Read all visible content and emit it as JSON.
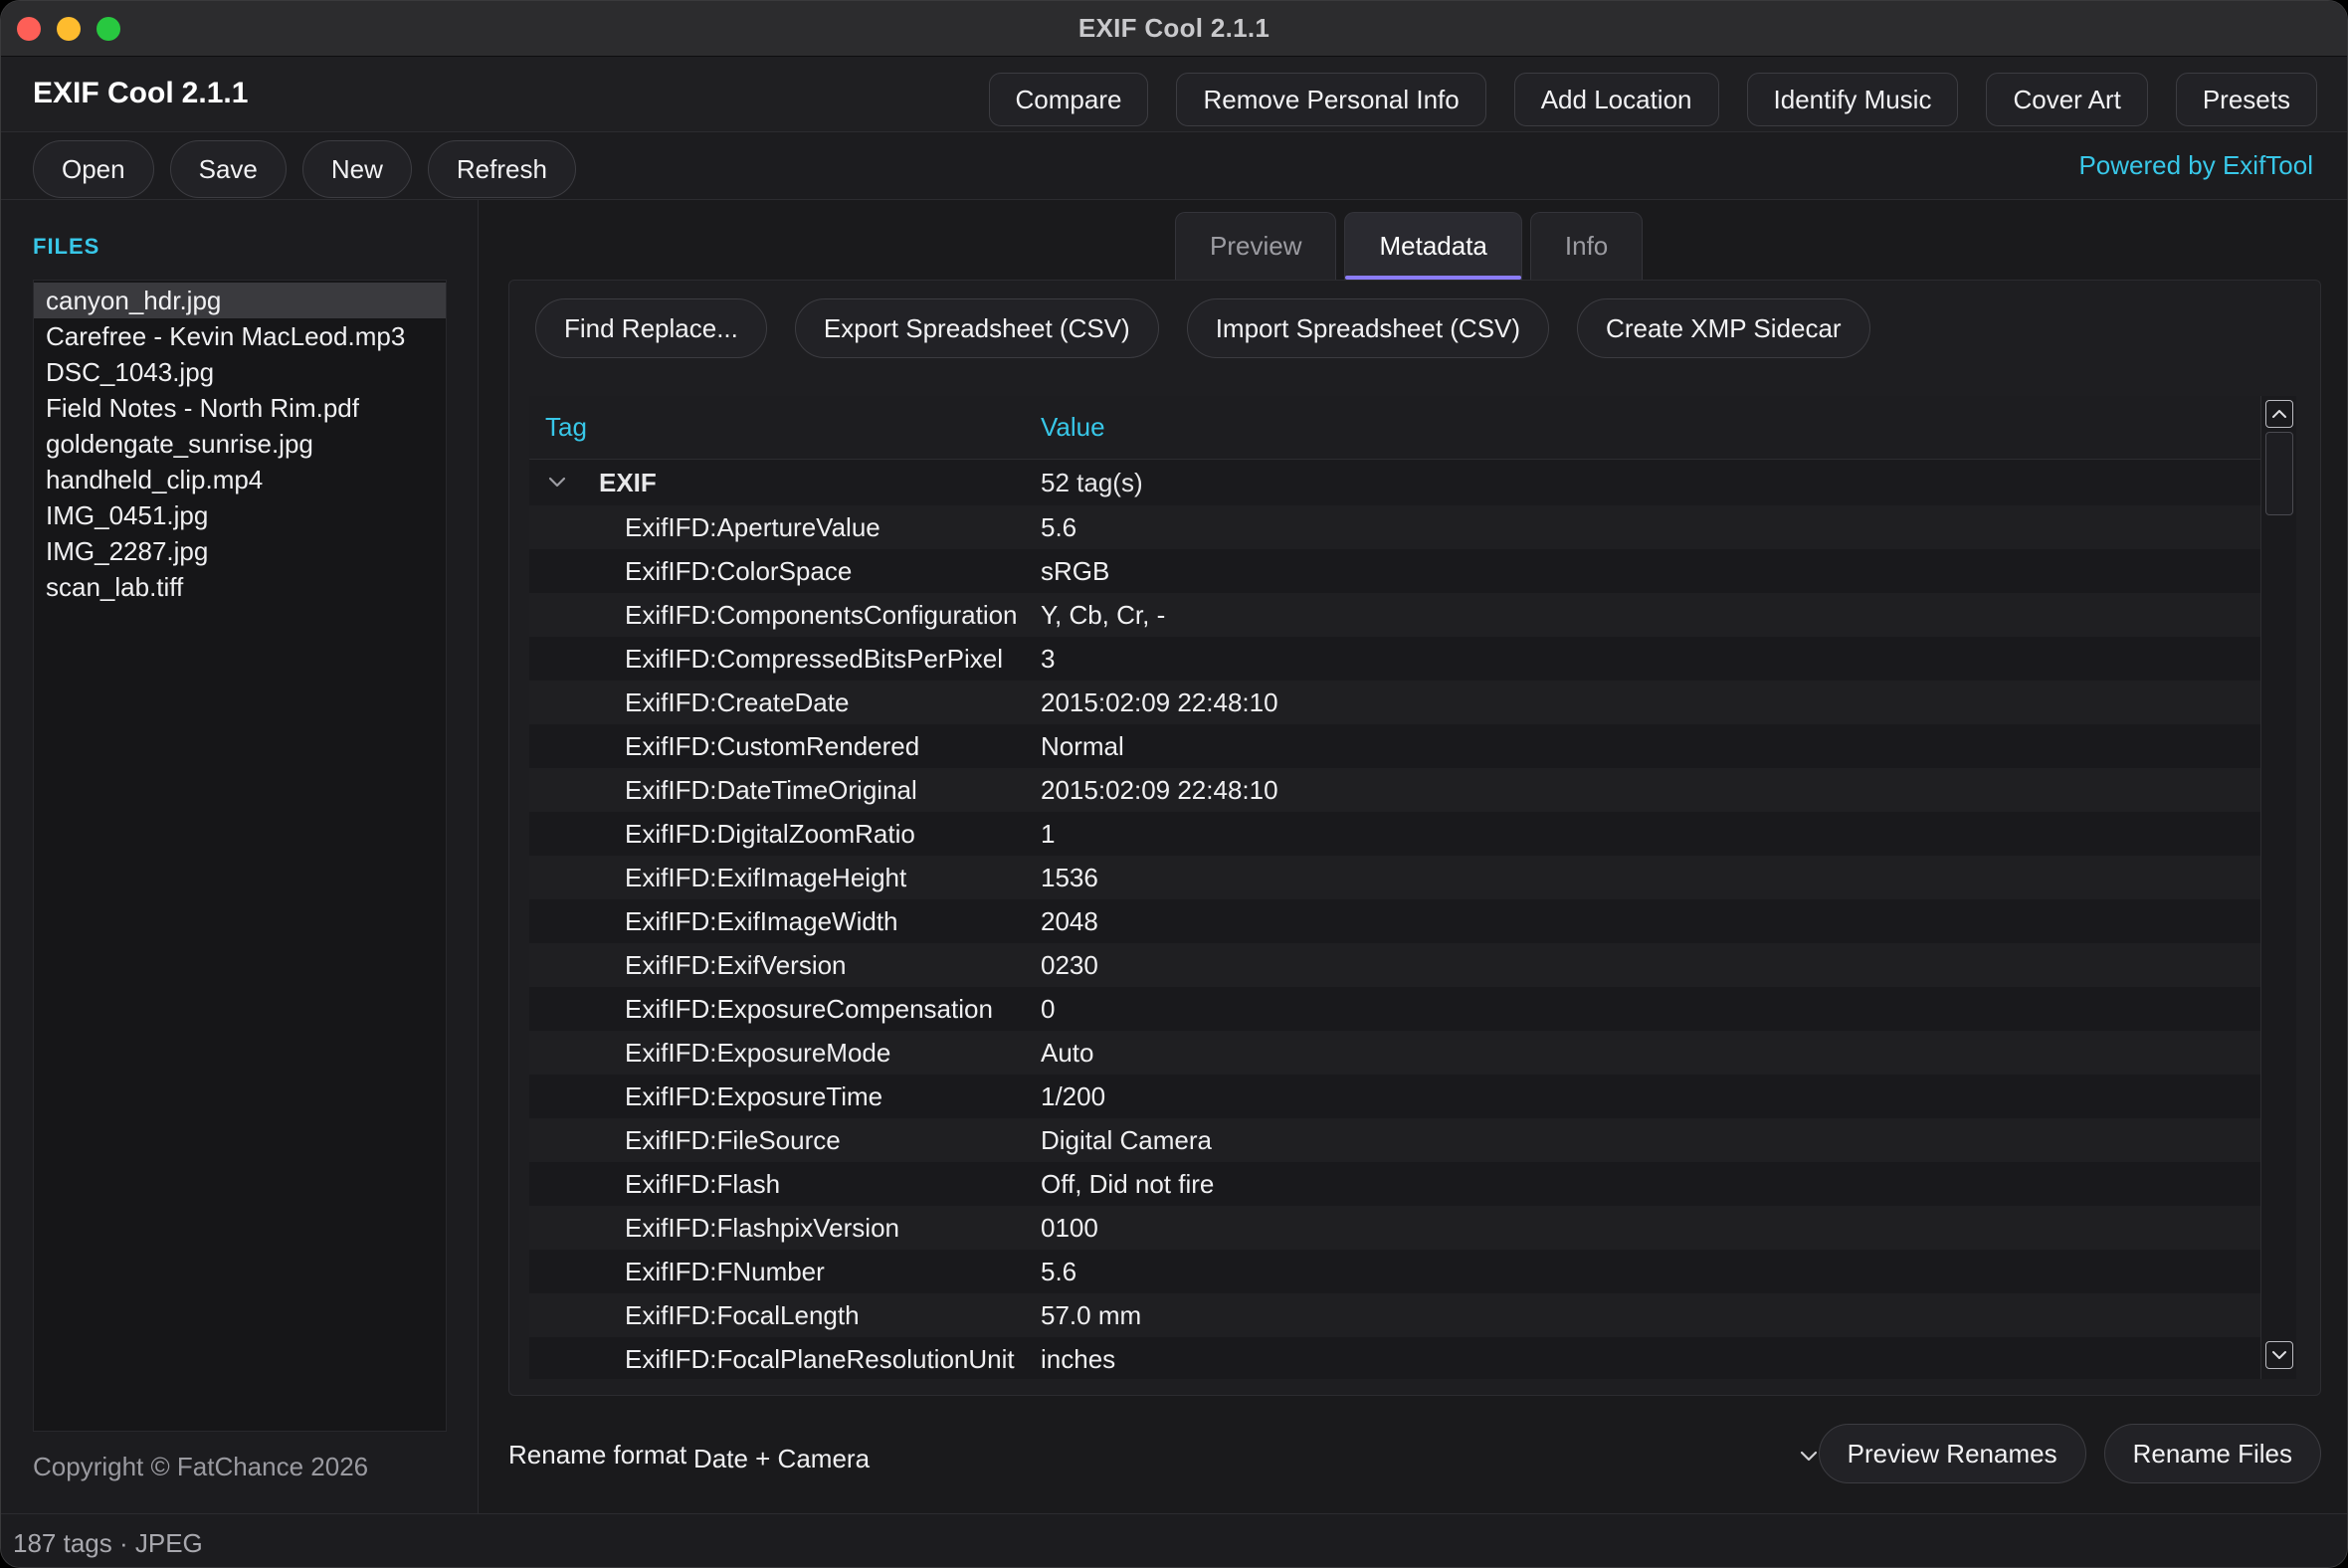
{
  "window": {
    "title": "EXIF Cool 2.1.1"
  },
  "header": {
    "app_name": "EXIF Cool",
    "app_version": "2.1.1",
    "actions": [
      "Compare",
      "Remove Personal Info",
      "Add Location",
      "Identify Music",
      "Cover Art",
      "Presets"
    ]
  },
  "toolbar": {
    "buttons": [
      "Open",
      "Save",
      "New",
      "Refresh"
    ],
    "powered_by": "Powered by ExifTool"
  },
  "sidebar": {
    "label": "FILES",
    "files": [
      "canyon_hdr.jpg",
      "Carefree - Kevin MacLeod.mp3",
      "DSC_1043.jpg",
      "Field Notes - North Rim.pdf",
      "goldengate_sunrise.jpg",
      "handheld_clip.mp4",
      "IMG_0451.jpg",
      "IMG_2287.jpg",
      "scan_lab.tiff"
    ],
    "selected_file": "canyon_hdr.jpg",
    "copyright": "Copyright © FatChance 2026"
  },
  "tabs": [
    "Preview",
    "Metadata",
    "Info"
  ],
  "active_tab": "Metadata",
  "panel_actions": [
    "Find  Replace...",
    "Export Spreadsheet (CSV)",
    "Import Spreadsheet (CSV)",
    "Create XMP Sidecar"
  ],
  "table": {
    "headers": {
      "tag": "Tag",
      "value": "Value"
    },
    "group": {
      "name": "EXIF",
      "count": "52 tag(s)"
    },
    "rows": [
      {
        "tag": "ExifIFD:ApertureValue",
        "value": "5.6"
      },
      {
        "tag": "ExifIFD:ColorSpace",
        "value": "sRGB"
      },
      {
        "tag": "ExifIFD:ComponentsConfiguration",
        "value": "Y, Cb, Cr, -"
      },
      {
        "tag": "ExifIFD:CompressedBitsPerPixel",
        "value": "3"
      },
      {
        "tag": "ExifIFD:CreateDate",
        "value": "2015:02:09 22:48:10"
      },
      {
        "tag": "ExifIFD:CustomRendered",
        "value": "Normal"
      },
      {
        "tag": "ExifIFD:DateTimeOriginal",
        "value": "2015:02:09 22:48:10"
      },
      {
        "tag": "ExifIFD:DigitalZoomRatio",
        "value": "1"
      },
      {
        "tag": "ExifIFD:ExifImageHeight",
        "value": "1536"
      },
      {
        "tag": "ExifIFD:ExifImageWidth",
        "value": "2048"
      },
      {
        "tag": "ExifIFD:ExifVersion",
        "value": "0230"
      },
      {
        "tag": "ExifIFD:ExposureCompensation",
        "value": "0"
      },
      {
        "tag": "ExifIFD:ExposureMode",
        "value": "Auto"
      },
      {
        "tag": "ExifIFD:ExposureTime",
        "value": "1/200"
      },
      {
        "tag": "ExifIFD:FileSource",
        "value": "Digital Camera"
      },
      {
        "tag": "ExifIFD:Flash",
        "value": "Off, Did not fire"
      },
      {
        "tag": "ExifIFD:FlashpixVersion",
        "value": "0100"
      },
      {
        "tag": "ExifIFD:FNumber",
        "value": "5.6"
      },
      {
        "tag": "ExifIFD:FocalLength",
        "value": "57.0 mm"
      },
      {
        "tag": "ExifIFD:FocalPlaneResolutionUnit",
        "value": "inches"
      }
    ]
  },
  "rename": {
    "label": "Rename format",
    "format": "Date + Camera",
    "buttons": [
      "Preview Renames",
      "Rename Files"
    ]
  },
  "status": {
    "text": "187 tags · JPEG"
  },
  "icons": {
    "chevron_down": "chevron-down-icon",
    "scroll_up": "scroll-up-arrow-icon",
    "scroll_down": "scroll-down-arrow-icon"
  },
  "colors": {
    "accent": "#38c7e8",
    "tab_indicator": "#8b7cf7",
    "close": "#fe5f57",
    "minimize": "#febc2e",
    "zoom": "#28c840"
  }
}
